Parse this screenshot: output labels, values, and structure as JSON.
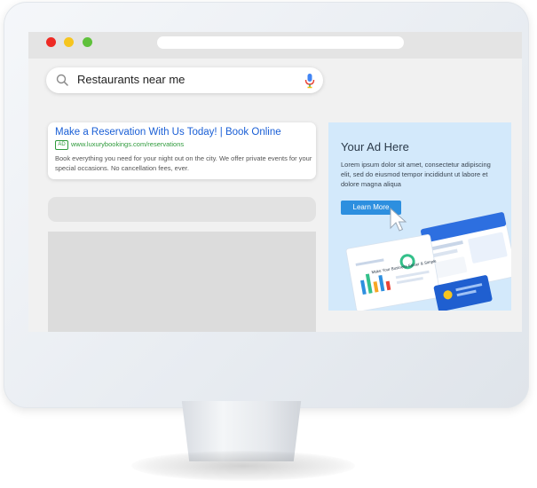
{
  "browser": {
    "window_controls": [
      "close",
      "minimize",
      "maximize"
    ]
  },
  "search": {
    "query": "Restaurants near me",
    "icons": {
      "left": "search-icon",
      "right": "microphone-icon"
    }
  },
  "ad_result": {
    "title": "Make a Reservation With Us Today! | Book Online",
    "badge": "AD",
    "url": "www.luxurybookings.com/reservations",
    "description": "Book everything you need for your night out on the city. We offer private events for your special occasions. No cancellation fees, ever."
  },
  "side_ad": {
    "title": "Your Ad Here",
    "body": "Lorem ipsum dolor sit amet, consectetur adipiscing elit, sed do eiusmod tempor incididunt ut labore et dolore magna aliqua",
    "button_label": "Learn More",
    "illustration_caption": "Make Your Business Easier & Simple"
  },
  "colors": {
    "ad_title": "#1a5fd6",
    "ad_url": "#2e9a3b",
    "side_ad_background": "#d3e9fb",
    "learn_more_button": "#2d8fdf",
    "close_dot": "#ee2a24",
    "minimize_dot": "#f6c51e",
    "maximize_dot": "#5fc13b"
  }
}
